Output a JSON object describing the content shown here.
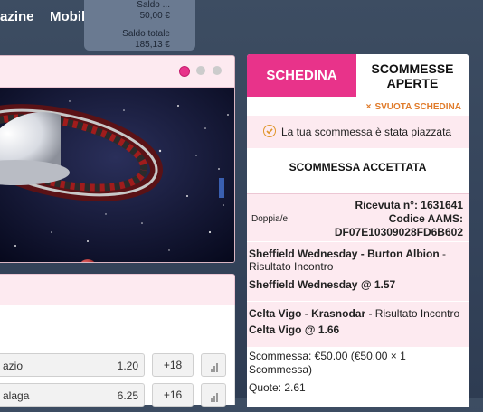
{
  "nav": {
    "item1": "azine",
    "item2": "Mobil"
  },
  "balance": {
    "cut_label": "Saldo ...",
    "cut_value": "50,00 €",
    "total_label": "Saldo totale",
    "total_value": "185,13 €"
  },
  "odds_rows": [
    {
      "name": "azio",
      "odd": "1.20",
      "more": "+18"
    },
    {
      "name": "alaga",
      "odd": "6.25",
      "more": "+16"
    }
  ],
  "colors": {
    "accent": "#e8338a",
    "dot_active": "#e8338a",
    "dot_inactive": "#cccccc",
    "clear": "#e07b2a"
  },
  "slip": {
    "tab_slip": "SCHEDINA",
    "tab_open_line1": "SCOMMESSE",
    "tab_open_line2": "APERTE",
    "clear_label": "SVUOTA SCHEDINA",
    "success_msg": "La tua scommessa è stata piazzata",
    "accepted": "SCOMMESSA ACCETTATA",
    "bet_type": "Doppia/e",
    "receipt": "Ricevuta n°: 1631641",
    "aams_label": "Codice AAMS:",
    "aams_code": "DF07E10309028FD6B602",
    "selections": [
      {
        "match_bold": "Sheffield Wednesday - Burton Albion",
        "market": " - ",
        "market2": "Risultato Incontro",
        "pick": "Sheffield Wednesday",
        "odd": "1.57"
      },
      {
        "match_bold": "Celta Vigo - Krasnodar",
        "market": " - Risultato Incontro",
        "pick": "Celta Vigo",
        "odd": "1.66"
      }
    ],
    "stake_line1": "Scommessa: €50.00 (€50.00 × 1",
    "stake_line2": "Scommessa)",
    "quote": "Quote: 2.61"
  }
}
